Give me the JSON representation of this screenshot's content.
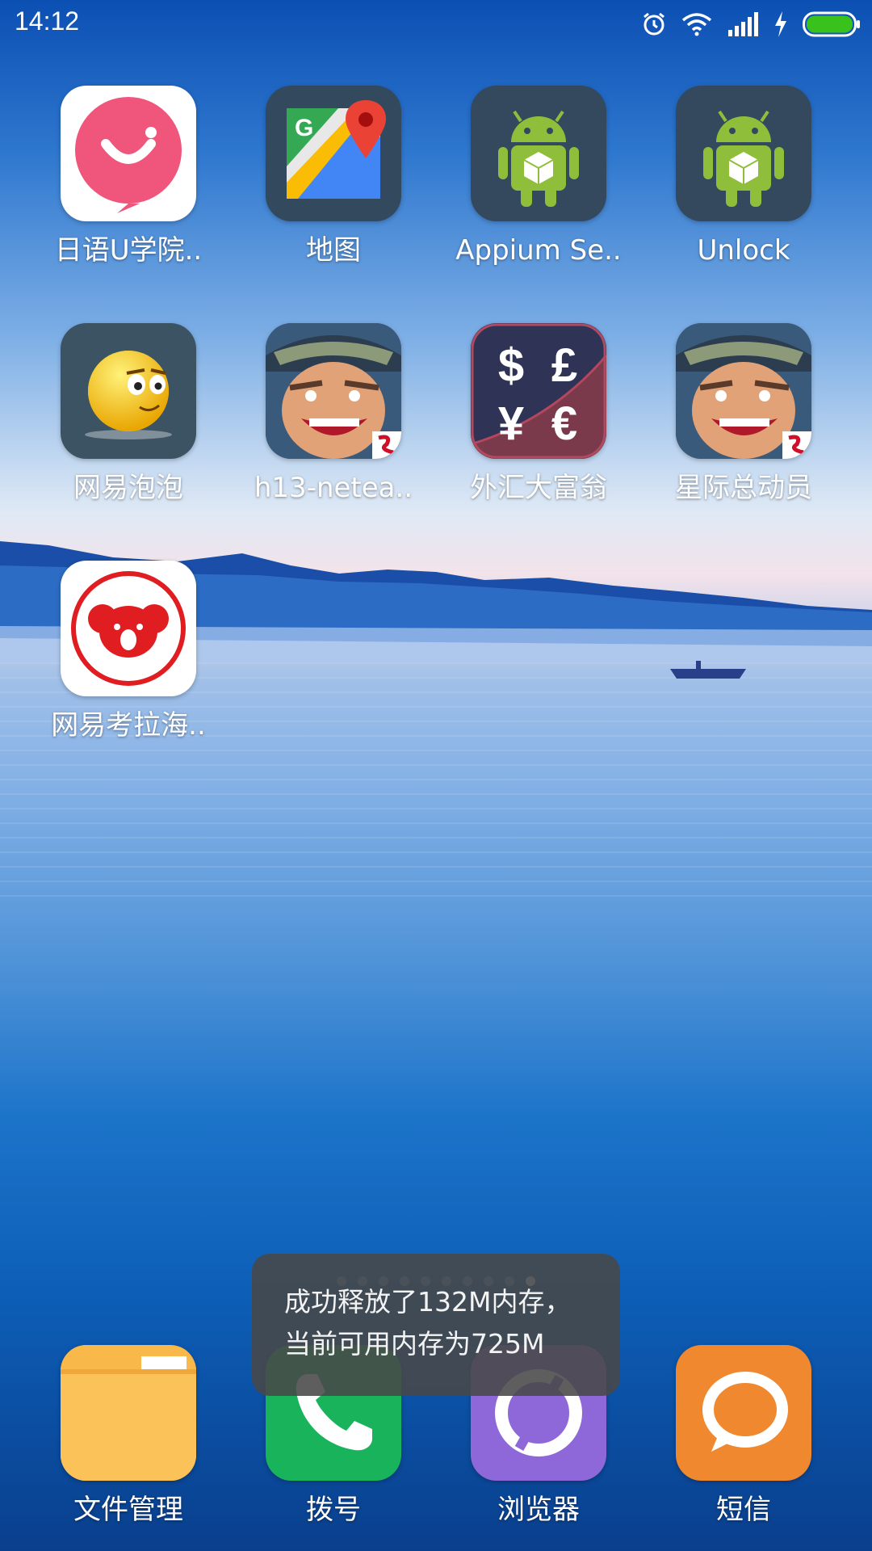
{
  "status_bar": {
    "time": "14:12",
    "icons": [
      "alarm-icon",
      "wifi-icon",
      "signal-icon",
      "charging-icon",
      "battery-icon"
    ],
    "battery_color": "#39c21b"
  },
  "apps": [
    {
      "label": "日语U学院..",
      "icon": "nihongo-u-icon"
    },
    {
      "label": "地图",
      "icon": "google-maps-icon"
    },
    {
      "label": "Appium Se..",
      "icon": "android-robot-icon"
    },
    {
      "label": "Unlock",
      "icon": "android-robot-icon"
    },
    {
      "label": "网易泡泡",
      "icon": "smiley-face-icon"
    },
    {
      "label": "h13-netea..",
      "icon": "game-hero-icon"
    },
    {
      "label": "外汇大富翁",
      "icon": "currency-icon"
    },
    {
      "label": "星际总动员",
      "icon": "game-hero-icon"
    },
    {
      "label": "网易考拉海..",
      "icon": "koala-icon"
    }
  ],
  "dock": [
    {
      "label": "文件管理",
      "icon": "folder-icon",
      "color": "#f8b84a"
    },
    {
      "label": "拨号",
      "icon": "phone-icon",
      "color": "#18b35a"
    },
    {
      "label": "浏览器",
      "icon": "browser-icon",
      "color": "#8e68d8"
    },
    {
      "label": "短信",
      "icon": "message-icon",
      "color": "#f0882f"
    }
  ],
  "currency_symbols": {
    "dollar": "$",
    "pound": "£",
    "yen": "¥",
    "euro": "€"
  },
  "maps_letter": "G",
  "toast": {
    "line1": "成功释放了132M内存，",
    "line2": "当前可用内存为725M"
  }
}
